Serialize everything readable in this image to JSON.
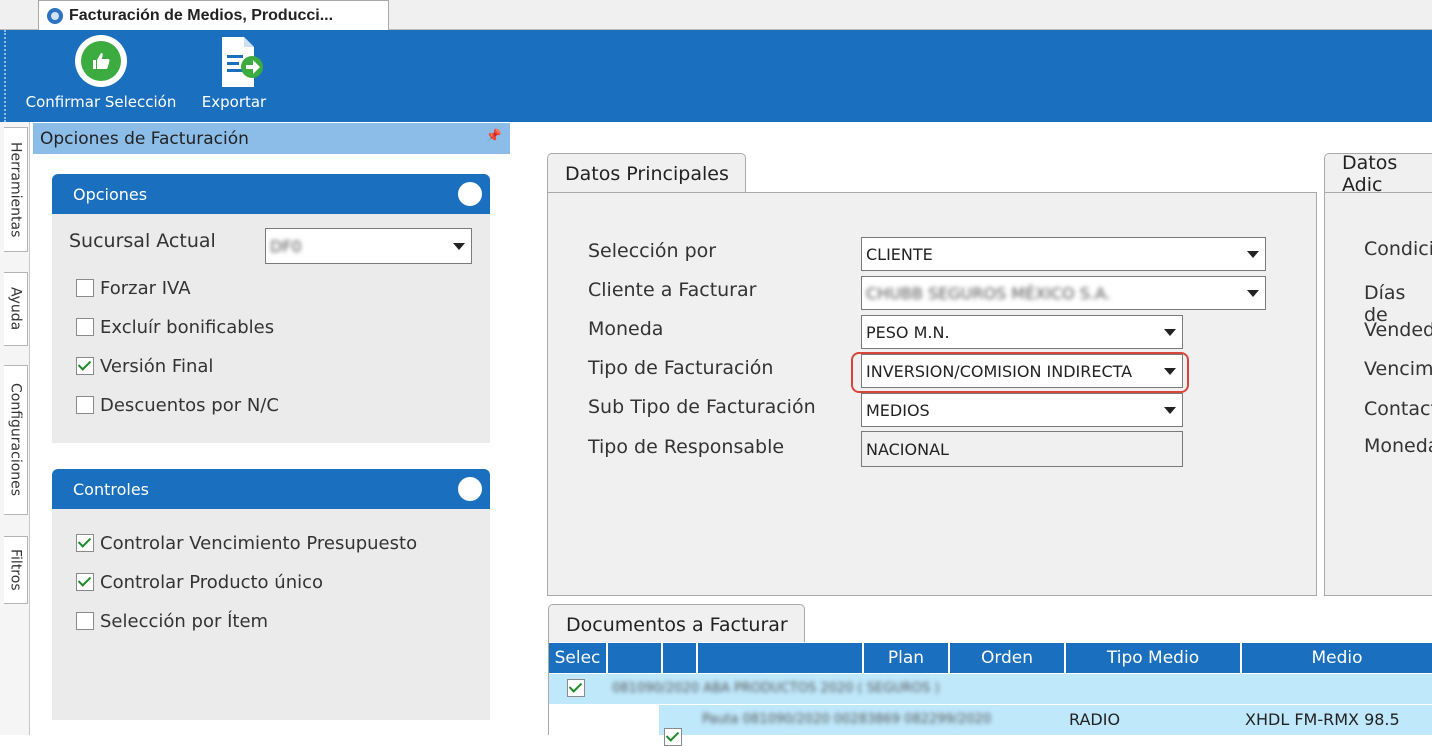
{
  "window": {
    "tab_title": "Facturación de Medios, Producci..."
  },
  "ribbon": {
    "confirm_label": "Confirmar Selección",
    "export_label": "Exportar"
  },
  "side_tabs": [
    "Herramientas",
    "Ayuda",
    "Configuraciones",
    "Filtros"
  ],
  "options_panel": {
    "title": "Opciones de Facturación",
    "opciones": {
      "title": "Opciones",
      "sucursal_label": "Sucursal Actual",
      "sucursal_value": "DF0",
      "checks": [
        {
          "label": "Forzar IVA",
          "checked": false
        },
        {
          "label": "Excluír bonificables",
          "checked": false
        },
        {
          "label": "Versión Final",
          "checked": true
        },
        {
          "label": "Descuentos por N/C",
          "checked": false
        }
      ]
    },
    "controles": {
      "title": "Controles",
      "checks": [
        {
          "label": "Controlar Vencimiento Presupuesto",
          "checked": true
        },
        {
          "label": "Controlar Producto único",
          "checked": true
        },
        {
          "label": "Selección por Ítem",
          "checked": false
        }
      ]
    }
  },
  "datos_principales": {
    "tab_label": "Datos Principales",
    "fields": [
      {
        "label": "Selección por",
        "value": "CLIENTE"
      },
      {
        "label": "Cliente a Facturar",
        "value": "CHUBB SEGUROS MÉXICO S.A."
      },
      {
        "label": "Moneda",
        "value": "PESO M.N."
      },
      {
        "label": "Tipo de Facturación",
        "value": "INVERSION/COMISION INDIRECTA"
      },
      {
        "label": "Sub Tipo de Facturación",
        "value": "MEDIOS"
      },
      {
        "label": "Tipo de Responsable",
        "value": "NACIONAL"
      }
    ]
  },
  "datos_adicionales": {
    "tab_label": "Datos Adic",
    "labels": [
      "Condici",
      "Días de",
      "Vended",
      "Vencim",
      "Contact",
      "Moneda"
    ]
  },
  "documentos": {
    "tab_label": "Documentos a Facturar",
    "columns": [
      "Selec",
      "",
      "",
      "",
      "Plan",
      "Orden",
      "Tipo Medio",
      "Medio"
    ],
    "group_row": {
      "text": "081090/2020 ABA PRODUCTOS 2020 ( SEGUROS )",
      "checked": true
    },
    "detail_row": {
      "text": "Pauta 081090/2020 00283869 082299/2020",
      "tipo_medio": "RADIO",
      "medio": "XHDL FM-RMX 98.5",
      "checked": true
    }
  },
  "colors": {
    "accent": "#1a70be",
    "highlight": "#d9453a",
    "row": "#bfe8fb"
  }
}
